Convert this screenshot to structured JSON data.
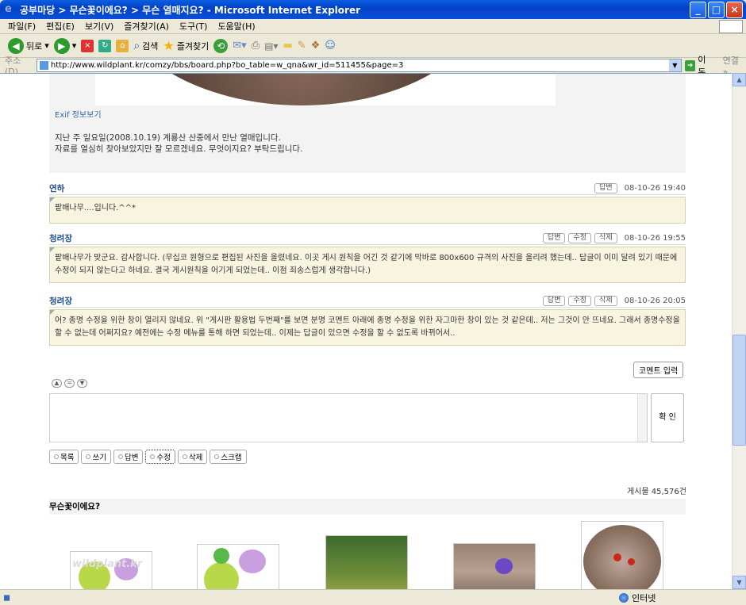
{
  "window": {
    "title": "공부마당 > 무슨꽃이에요? > 무슨 열매지요? - Microsoft Internet Explorer"
  },
  "menu": [
    "파일(F)",
    "편집(E)",
    "보기(V)",
    "즐겨찾기(A)",
    "도구(T)",
    "도움말(H)"
  ],
  "toolbar": {
    "back": "뒤로",
    "search": "검색",
    "favorites": "즐겨찾기"
  },
  "address": {
    "label": "주소(D)",
    "url": "http://www.wildplant.kr/comzy/bbs/board.php?bo_table=w_qna&wr_id=511455&page=3",
    "go": "이동",
    "links": "연결"
  },
  "post": {
    "exif": "Exif 정보보기",
    "line1": "지난 주 일요일(2008.10.19) 계룡산 산중에서 만난 열매입니다.",
    "line2": "자료를 열심히 찾아보았지만 잘 모르겠네요. 무엇이지요? 부탁드립니다."
  },
  "comments": [
    {
      "author": "연하",
      "buttons": [
        "답변"
      ],
      "date": "08-10-26 19:40",
      "body": "팥배나무....입니다.^^*"
    },
    {
      "author": "청려장",
      "buttons": [
        "답변",
        "수정",
        "삭제"
      ],
      "date": "08-10-26 19:55",
      "body": "팥배나무가 맞군요. 감사합니다. (무십코 원형으로 편집된 사진을 올렸네요. 이곳 게시 원칙을 어긴 것 같기에 막바로 800x600 규격의 사진을 올리려 했는데.. 답글이 이미 달려 있기 때문에 수정이 되지 않는다고 하네요. 결국 게시원칙을 어기게 되었는데.. 이점 죄송스럽게 생각합니다.)"
    },
    {
      "author": "청려장",
      "buttons": [
        "답변",
        "수정",
        "삭제"
      ],
      "date": "08-10-26 20:05",
      "body": "어? 종명 수정을 위한 창이 열리지 않네요. 위 \"게시판 활용법 두번째\"를 보면 분명 코멘트 아래에 종명 수정을 위한 자그마한 창이 있는 것 같은데.. 저는 그것이 안 뜨네요. 그래서 종명수정을 할 수 없는데 어쩌지요? 예전에는 수정 메뉴를 통해 하면 되었는데.. 이제는 답글이 있으면 수정을 할 수 없도록 바뀌어서.."
    }
  ],
  "comment_form": {
    "input_button": "코멘트 입력",
    "confirm": "확 인"
  },
  "actions": [
    "목록",
    "쓰기",
    "답변",
    "수정",
    "삭제",
    "스크랩"
  ],
  "post_count": "게시물 45,576건",
  "section_title": "무슨꽃이에요?",
  "thumb_watermark": "wildplant.kr",
  "status": {
    "zone": "인터넷"
  }
}
